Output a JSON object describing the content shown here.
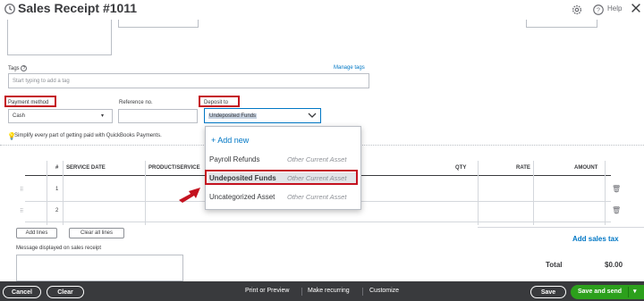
{
  "header": {
    "title": "Sales Receipt #1011",
    "help_label": "Help"
  },
  "tags": {
    "label": "Tags",
    "manage_link": "Manage tags",
    "placeholder": "Start typing to add a tag"
  },
  "payment_method": {
    "label": "Payment method",
    "value": "Cash"
  },
  "reference": {
    "label": "Reference no.",
    "value": ""
  },
  "deposit_to": {
    "label": "Deposit to",
    "value": "Undeposited Funds"
  },
  "tip": {
    "text": "Simplify every part of getting paid with QuickBooks Payments."
  },
  "dropdown": {
    "add_new": "+ Add new",
    "items": [
      {
        "name": "Payroll Refunds",
        "type": "Other Current Asset"
      },
      {
        "name": "Undeposited Funds",
        "type": "Other Current Asset",
        "selected": true
      },
      {
        "name": "Uncategorized Asset",
        "type": "Other Current Asset"
      }
    ]
  },
  "table": {
    "columns": [
      "#",
      "SERVICE DATE",
      "PRODUCT/SERVICE",
      "QTY",
      "RATE",
      "AMOUNT"
    ],
    "rows": [
      {
        "num": "1"
      },
      {
        "num": "2"
      }
    ]
  },
  "lines": {
    "add_lines": "Add lines",
    "clear_all_lines": "Clear all lines"
  },
  "message": {
    "label": "Message displayed on sales receipt",
    "value": ""
  },
  "totals": {
    "add_sales_tax": "Add sales tax",
    "total_label": "Total",
    "total_value": "$0.00"
  },
  "footer": {
    "cancel": "Cancel",
    "clear": "Clear",
    "print_preview": "Print or Preview",
    "make_recurring": "Make recurring",
    "customize": "Customize",
    "save": "Save",
    "save_and_send": "Save and send"
  },
  "colors": {
    "highlight": "#c4121f",
    "link": "#0077c5",
    "primary_button": "#2ca01c",
    "footer": "#393a3d"
  }
}
